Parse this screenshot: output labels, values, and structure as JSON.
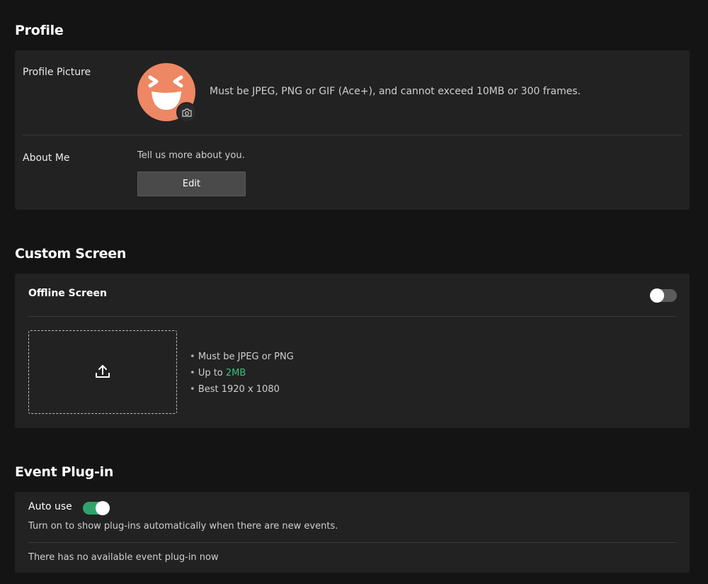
{
  "profile": {
    "title": "Profile",
    "picture_label": "Profile Picture",
    "picture_note": "Must be JPEG, PNG or GIF (Ace+), and cannot exceed 10MB or 300 frames.",
    "about_label": "About Me",
    "about_hint": "Tell us more about you.",
    "edit_label": "Edit",
    "avatar_color": "#ee8763"
  },
  "custom_screen": {
    "title": "Custom Screen",
    "offline_label": "Offline Screen",
    "offline_enabled": false,
    "upload_icon": "upload-icon",
    "requirements": {
      "format": "Must be JPEG or PNG",
      "size_prefix": "Up to ",
      "size_value": "2MB",
      "resolution": "Best 1920 x 1080"
    }
  },
  "event_plugin": {
    "title": "Event Plug-in",
    "auto_use_label": "Auto use",
    "auto_use_enabled": true,
    "auto_use_desc": "Turn on to show plug-ins automatically when there are new events.",
    "none_available": "There has no available event plug-in now"
  },
  "colors": {
    "background": "#141414",
    "card": "#222222",
    "accent_green": "#2fa36b",
    "size_highlight": "#3cbf7c"
  }
}
